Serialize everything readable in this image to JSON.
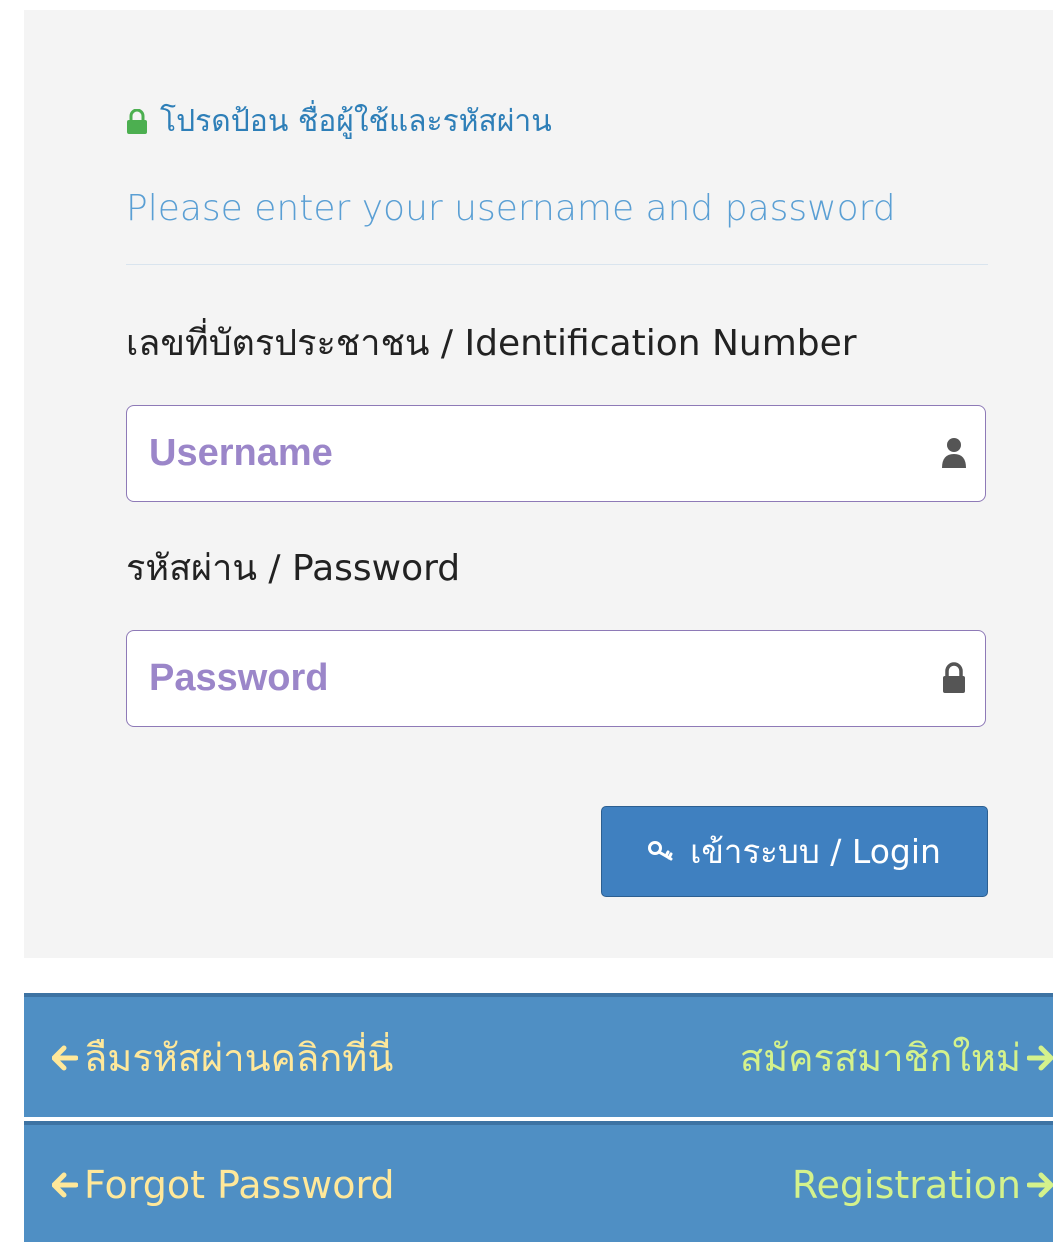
{
  "login": {
    "heading": "โปรดป้อน ชื่อผู้ใช้และรหัสผ่าน",
    "subheading": "Please enter your username and password",
    "id_label": "เลขที่บัตรประชาชน / Identification Number",
    "username_placeholder": "Username",
    "password_label": "รหัสผ่าน / Password",
    "password_placeholder": "Password",
    "login_button": "เข้าระบบ / Login",
    "icons": {
      "heading": "lock-icon",
      "username": "user-icon",
      "password": "lock-icon",
      "login": "key-icon"
    }
  },
  "footer": {
    "row1": {
      "forgot_label": "ลืมรหัสผ่านคลิกที่นี่",
      "register_label": "สมัครสมาชิกใหม่"
    },
    "row2": {
      "forgot_label": "Forgot Password",
      "register_label": "Registration"
    },
    "icons": {
      "forgot": "arrow-left-icon",
      "register": "arrow-right-icon"
    }
  },
  "colors": {
    "heading": "#2e7fb8",
    "lock_green": "#4caf50",
    "placeholder": "#9b86c9",
    "button": "#3f80c0",
    "footer_bar": "#4f8fc4",
    "forgot_link": "#ffe89a",
    "register_link": "#d4f28c"
  }
}
